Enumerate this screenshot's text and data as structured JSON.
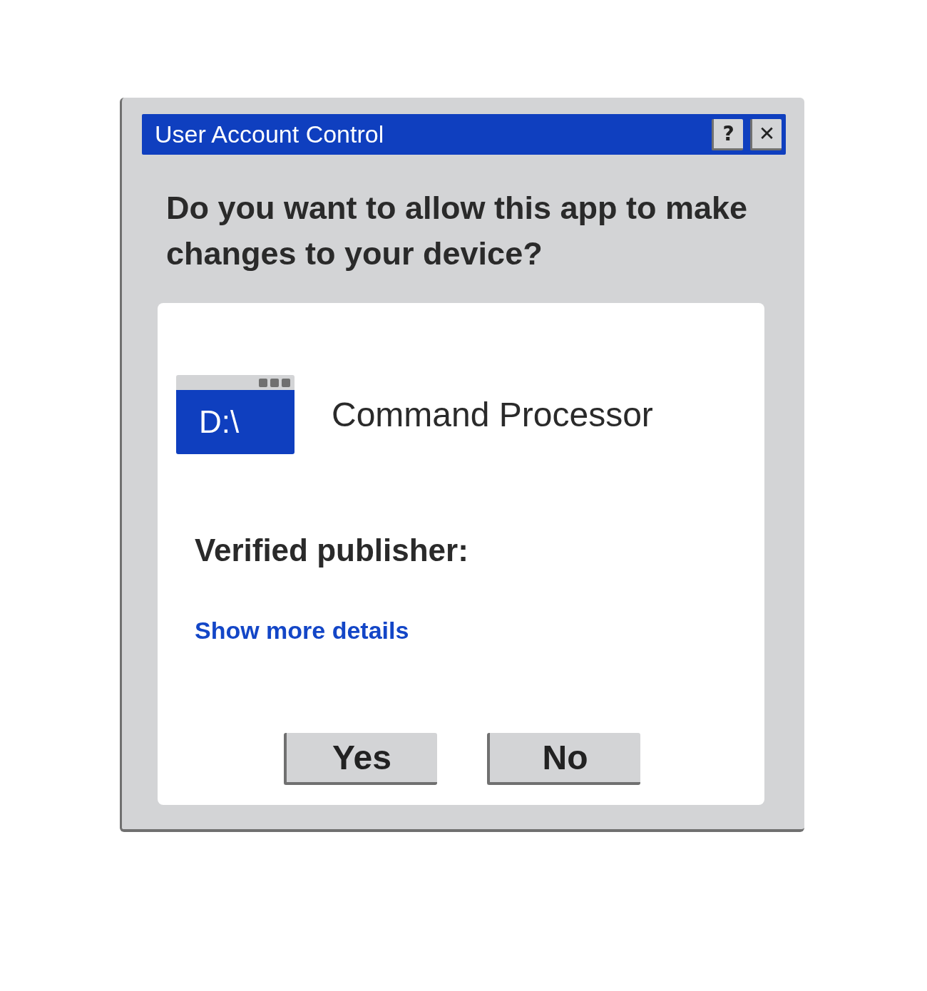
{
  "window": {
    "title": "User Account Control",
    "title_buttons": [
      "?",
      "✕"
    ]
  },
  "question": "Do you want to allow this app to make changes to your device?",
  "app": {
    "icon_text": "D:\\",
    "name": "Command Processor"
  },
  "publisher_label": "Verified publisher:",
  "details_link": "Show more details",
  "buttons": [
    "Yes",
    "No"
  ]
}
